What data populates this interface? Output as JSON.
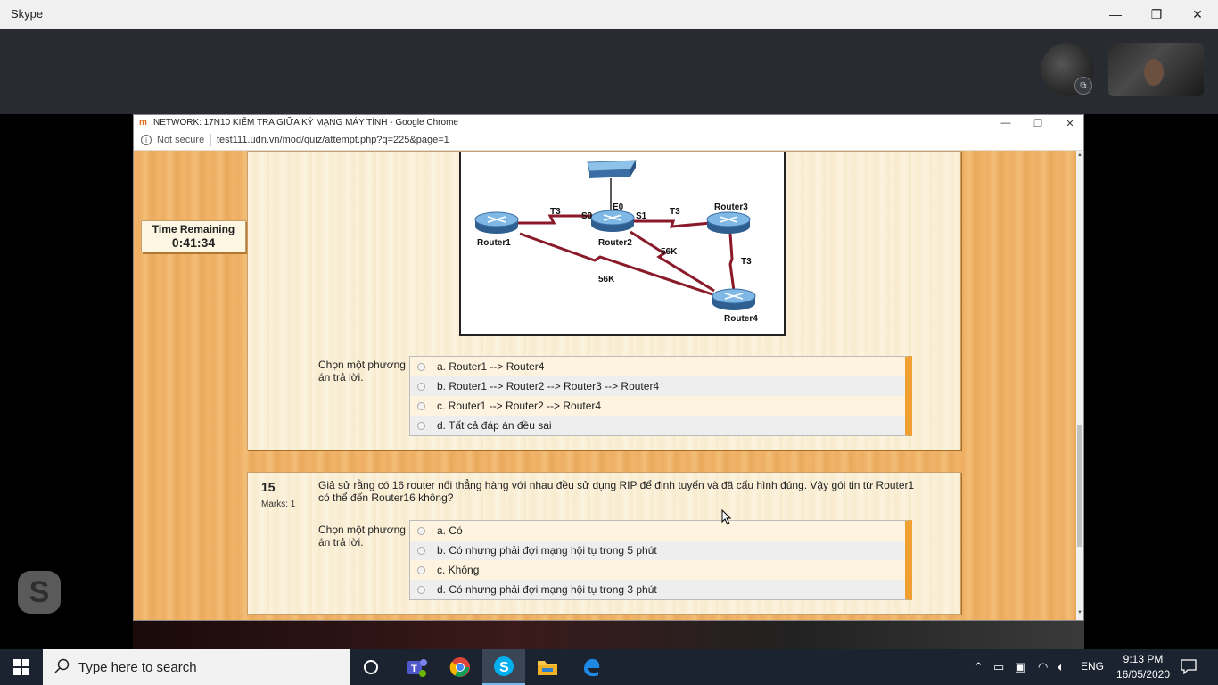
{
  "skype": {
    "title": "Skype",
    "controls": {
      "minimize": "—",
      "maximize": "❐",
      "close": "✕"
    },
    "popout_glyph": "⧉",
    "logo": "S"
  },
  "chrome": {
    "favicon": "m",
    "title": "NETWORK: 17N10 KIỂM TRA GIỮA KỲ MẠNG MÁY TÍNH - Google Chrome",
    "not_secure": "Not secure",
    "url": "test111.udn.vn/mod/quiz/attempt.php?q=225&page=1"
  },
  "timer": {
    "label": "Time Remaining",
    "value": "0:41:34"
  },
  "diagram": {
    "labels": {
      "t3_left": "T3",
      "s0": "S0",
      "e0": "E0",
      "s1": "S1",
      "t3_right": "T3",
      "router3": "Router3",
      "router1": "Router1",
      "router2": "Router2",
      "k56_upper": "56K",
      "t3_vertical": "T3",
      "k56_lower": "56K",
      "router4": "Router4"
    }
  },
  "q14": {
    "choose_label": "Chọn một phương án trả lời.",
    "answers": [
      "a. Router1 --> Router4",
      "b. Router1 --> Router2 --> Router3 --> Router4",
      "c. Router1 --> Router2 --> Router4",
      "d. Tất cả đáp án đều sai"
    ]
  },
  "q15": {
    "number": "15",
    "marks": "Marks: 1",
    "text": "Giả sử rằng có 16 router nối thẳng hàng với nhau đều sử dụng RIP để định tuyến và đã cấu hình đúng. Vậy gói tin từ Router1 có thể đến Router16 không?",
    "choose_label": "Chọn một phương án trả lời.",
    "answers": [
      "a. Có",
      "b. Có nhưng phải đợi mạng hội tụ trong 5 phút",
      "c. Không",
      "d. Có nhưng phải đợi mạng hội tụ trong 3 phút"
    ]
  },
  "taskbar": {
    "search_placeholder": "Type here to search",
    "language": "ENG",
    "time": "9:13 PM",
    "date": "16/05/2020"
  }
}
